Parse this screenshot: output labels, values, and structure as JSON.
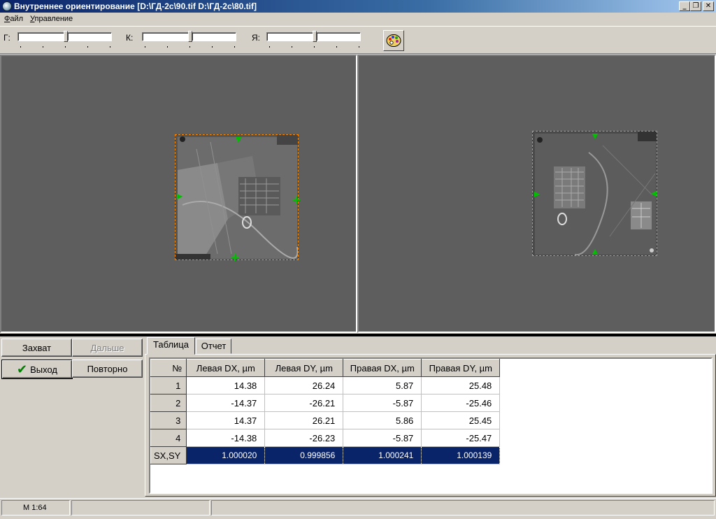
{
  "window": {
    "title": "Внутреннее ориентирование [D:\\ГД-2с\\90.tif  D:\\ГД-2с\\80.tif]",
    "minimize": "_",
    "restore": "❐",
    "close": "✕"
  },
  "menu": {
    "file_first": "Ф",
    "file_rest": "айл",
    "control_first": "У",
    "control_rest": "правление"
  },
  "toolbar": {
    "g_label": "Г:",
    "k_label": "К:",
    "ya_label": "Я:"
  },
  "buttons": {
    "capture": "Захват",
    "next": "Дальше",
    "exit": "Выход",
    "repeat": "Повторно"
  },
  "tabs": {
    "table": "Таблица",
    "report": "Отчет"
  },
  "table": {
    "headers": [
      "№",
      "Левая DX, µm",
      "Левая DY, µm",
      "Правая DX, µm",
      "Правая DY, µm"
    ],
    "rows": [
      {
        "n": "1",
        "ldx": "14.38",
        "ldy": "26.24",
        "rdx": "5.87",
        "rdy": "25.48"
      },
      {
        "n": "2",
        "ldx": "-14.37",
        "ldy": "-26.21",
        "rdx": "-5.87",
        "rdy": "-25.46"
      },
      {
        "n": "3",
        "ldx": "14.37",
        "ldy": "26.21",
        "rdx": "5.86",
        "rdy": "25.45"
      },
      {
        "n": "4",
        "ldx": "-14.38",
        "ldy": "-26.23",
        "rdx": "-5.87",
        "rdy": "-25.47"
      },
      {
        "n": "SX,SY",
        "ldx": "1.000020",
        "ldy": "0.999856",
        "rdx": "1.000241",
        "rdy": "1.000139"
      }
    ]
  },
  "status": {
    "scale": "М 1:64"
  },
  "colors": {
    "selection": "#0a246a",
    "marker": "#00c000",
    "frame": "#ff8c00",
    "viewport_bg": "#5e5e5e"
  }
}
